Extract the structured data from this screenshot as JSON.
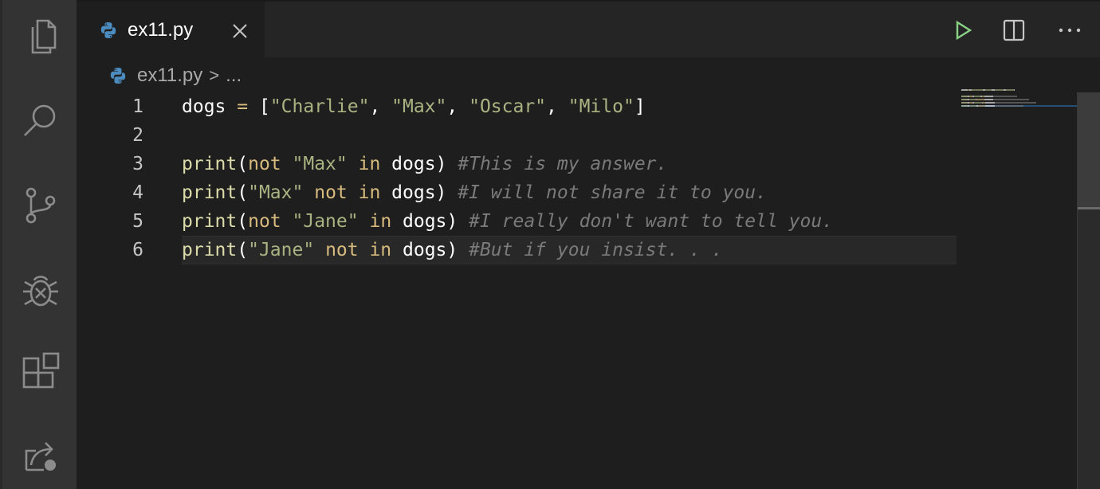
{
  "tab": {
    "filename": "ex11.py",
    "close_icon": "close-icon",
    "language_icon": "python-icon"
  },
  "toolbar": {
    "run_icon": "run-icon",
    "split_icon": "split-editor-icon",
    "more_icon": "more-actions-icon"
  },
  "breadcrumb": {
    "file": "ex11.py",
    "separator": ">",
    "more": "..."
  },
  "activity_bar": [
    {
      "name": "explorer",
      "icon": "files-icon"
    },
    {
      "name": "search",
      "icon": "search-icon"
    },
    {
      "name": "source-control",
      "icon": "source-control-icon"
    },
    {
      "name": "run-and-debug",
      "icon": "debug-icon"
    },
    {
      "name": "extensions",
      "icon": "extensions-icon"
    },
    {
      "name": "remote-explorer",
      "icon": "remote-explorer-icon"
    }
  ],
  "code": {
    "active_line": 6,
    "lines": [
      {
        "num": "1",
        "tokens": [
          {
            "t": "id",
            "v": "dogs "
          },
          {
            "t": "op",
            "v": "="
          },
          {
            "t": "id",
            "v": " ["
          },
          {
            "t": "str",
            "v": "\"Charlie\""
          },
          {
            "t": "id",
            "v": ", "
          },
          {
            "t": "str",
            "v": "\"Max\""
          },
          {
            "t": "id",
            "v": ", "
          },
          {
            "t": "str",
            "v": "\"Oscar\""
          },
          {
            "t": "id",
            "v": ", "
          },
          {
            "t": "str",
            "v": "\"Milo\""
          },
          {
            "t": "id",
            "v": "]"
          }
        ]
      },
      {
        "num": "2",
        "tokens": []
      },
      {
        "num": "3",
        "tokens": [
          {
            "t": "fn",
            "v": "print"
          },
          {
            "t": "id",
            "v": "("
          },
          {
            "t": "kw",
            "v": "not"
          },
          {
            "t": "id",
            "v": " "
          },
          {
            "t": "str",
            "v": "\"Max\""
          },
          {
            "t": "id",
            "v": " "
          },
          {
            "t": "kw",
            "v": "in"
          },
          {
            "t": "id",
            "v": " dogs) "
          },
          {
            "t": "cmt",
            "v": "#This is my answer."
          }
        ]
      },
      {
        "num": "4",
        "tokens": [
          {
            "t": "fn",
            "v": "print"
          },
          {
            "t": "id",
            "v": "("
          },
          {
            "t": "str",
            "v": "\"Max\""
          },
          {
            "t": "id",
            "v": " "
          },
          {
            "t": "kw",
            "v": "not in"
          },
          {
            "t": "id",
            "v": " dogs) "
          },
          {
            "t": "cmt",
            "v": "#I will not share it to you."
          }
        ]
      },
      {
        "num": "5",
        "tokens": [
          {
            "t": "fn",
            "v": "print"
          },
          {
            "t": "id",
            "v": "("
          },
          {
            "t": "kw",
            "v": "not"
          },
          {
            "t": "id",
            "v": " "
          },
          {
            "t": "str",
            "v": "\"Jane\""
          },
          {
            "t": "id",
            "v": " "
          },
          {
            "t": "kw",
            "v": "in"
          },
          {
            "t": "id",
            "v": " dogs) "
          },
          {
            "t": "cmt",
            "v": "#I really don't want to tell you."
          }
        ]
      },
      {
        "num": "6",
        "tokens": [
          {
            "t": "fn",
            "v": "print"
          },
          {
            "t": "id",
            "v": "("
          },
          {
            "t": "str",
            "v": "\"Jane\""
          },
          {
            "t": "id",
            "v": " "
          },
          {
            "t": "kw",
            "v": "not in"
          },
          {
            "t": "id",
            "v": " dogs) "
          },
          {
            "t": "cmt",
            "v": "#But if you insist. . ."
          }
        ]
      }
    ]
  },
  "colors": {
    "function": "#dcdcaa",
    "keyword": "#d7ba7d",
    "string": "#a9b381",
    "comment": "#7a7a7a",
    "identifier": "#ffffff",
    "run_icon": "#89d185"
  }
}
